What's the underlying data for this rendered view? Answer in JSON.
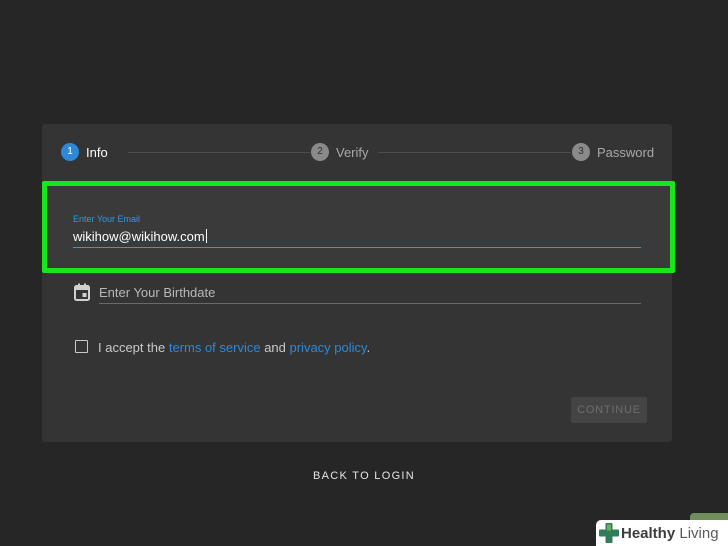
{
  "stepper": {
    "steps": [
      {
        "number": "1",
        "label": "Info"
      },
      {
        "number": "2",
        "label": "Verify"
      },
      {
        "number": "3",
        "label": "Password"
      }
    ],
    "active_step": 1
  },
  "email": {
    "label": "Enter Your Email",
    "value": "wikihow@wikihow.com"
  },
  "birthdate": {
    "placeholder": "Enter Your Birthdate",
    "icon": "calendar-icon"
  },
  "terms": {
    "prefix": "I accept the ",
    "terms_link": "terms of service",
    "middle": " and ",
    "privacy_link": "privacy policy",
    "suffix": ".",
    "checked": false
  },
  "actions": {
    "continue_label": "CONTINUE",
    "back_label": "BACK TO LOGIN"
  },
  "watermark": {
    "brand_bold": "Healthy",
    "brand_thin": " Living"
  },
  "colors": {
    "background": "#262626",
    "card": "#343434",
    "accent": "#2d88d9",
    "highlight": "#19e619"
  }
}
